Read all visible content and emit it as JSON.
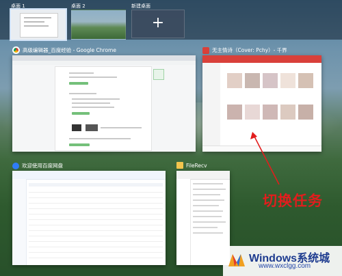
{
  "desktops": [
    {
      "label": "桌面 1",
      "active": true
    },
    {
      "label": "桌面 2",
      "active": false
    },
    {
      "label": "新建桌面",
      "icon": "plus-icon",
      "symbol": "+"
    }
  ],
  "windows": {
    "chrome": {
      "title": "高级编辑器_百度经验 - Google Chrome",
      "icon": "chrome-icon",
      "accent": "#e74c3c"
    },
    "music": {
      "title": "无主情诗（Cover: Pchy）- 千界",
      "icon": "music-app-icon",
      "accent": "#d9403a"
    },
    "baidupan": {
      "title": "欢迎使用百度网盘",
      "icon": "cloud-drive-icon",
      "accent": "#2f7cf6"
    },
    "filerecv": {
      "title": "FileRecv",
      "icon": "folder-icon",
      "accent": "#f3c54d"
    }
  },
  "annotation": {
    "text": "切换任务",
    "color": "#e21d1d"
  },
  "watermark": {
    "title": "Windows系统城",
    "url": "www.wxclgg.com",
    "icon": "windows-logo-icon"
  }
}
